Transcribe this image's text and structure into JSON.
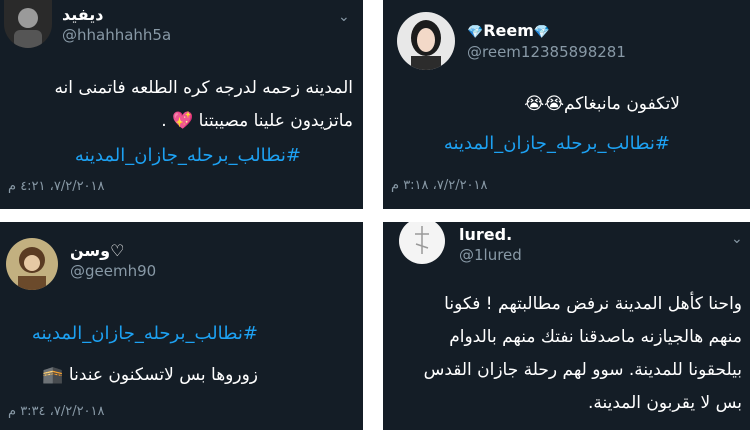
{
  "tweets": [
    {
      "name": "ديفيد",
      "handle": "@hhahhahh5a",
      "lines": [
        "المدينه زحمه لدرجه كره الطلعه فاتمنى انه",
        "ماتزيدون علينا مصيبتنا 💖 ."
      ],
      "hashtag": "#نطالب_برحله_جازان_المدينه",
      "date": "٧/٢/٢٠١٨، ٤:٢١ م"
    },
    {
      "name": "Reem",
      "badge": "💎",
      "handle": "@reem12385898281",
      "lines": [
        "لاتكفون مانبغاكم😭😭"
      ],
      "hashtag": "#نطالب_برحله_جازان_المدينه",
      "date": "٧/٢/٢٠١٨، ٣:١٨ م"
    },
    {
      "name": "وسن♡",
      "handle": "@geemh90",
      "hashtag": "#نطالب_برحله_جازان_المدينه",
      "lines": [
        "زوروها بس لاتسكنون عندنا 🕋"
      ],
      "date": "٧/٢/٢٠١٨، ٣:٣٤ م"
    },
    {
      "name": "lured.",
      "handle": "@1lured",
      "lines": [
        "واحنا كأهل المدينة نرفض مطالبتهم ! فكونا",
        "منهم هالجيازنه ماصدقنا نفتك منهم بالدوام",
        "بيلحقونا للمدينة. سوو لهم رحلة جازان القدس",
        "بس لا يقربون المدينة."
      ]
    }
  ],
  "colors": {
    "card_bg": "#141d26",
    "hashtag": "#1da1f2",
    "muted": "#8899a6"
  },
  "icons": {
    "menu": "chevron-down-icon"
  }
}
